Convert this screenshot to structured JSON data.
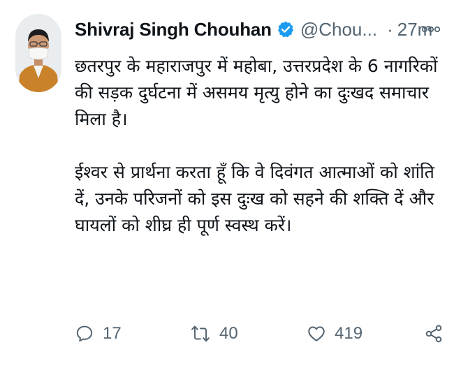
{
  "tweet": {
    "author": {
      "name": "Shivraj Singh Chouhan",
      "handle": "@Chou...",
      "verified": true,
      "avatar_icon": "profile-photo"
    },
    "separator": "·",
    "time": "27m",
    "body": [
      "छतरपुर के महाराजपुर में महोबा, उत्तरप्रदेश के 6 नागरिकों की सड़क दुर्घटना में असमय मृत्यु होने का दुःखद समाचार मिला है।",
      "ईश्वर से प्रार्थना करता हूँ कि वे दिवंगत आत्माओं को शांति दें, उनके परिजनों को इस दुःख को सहने की शक्ति दें और घायलों को शीघ्र ही पूर्ण स्वस्थ करें।"
    ],
    "actions": {
      "reply": {
        "icon": "reply-icon",
        "count": "17"
      },
      "retweet": {
        "icon": "retweet-icon",
        "count": "40"
      },
      "like": {
        "icon": "heart-icon",
        "count": "419"
      },
      "share": {
        "icon": "share-icon"
      }
    },
    "more_icon": "more-icon"
  },
  "colors": {
    "text": "#0f1419",
    "muted": "#536471",
    "verified": "#1d9bf0",
    "background": "#ffffff"
  }
}
